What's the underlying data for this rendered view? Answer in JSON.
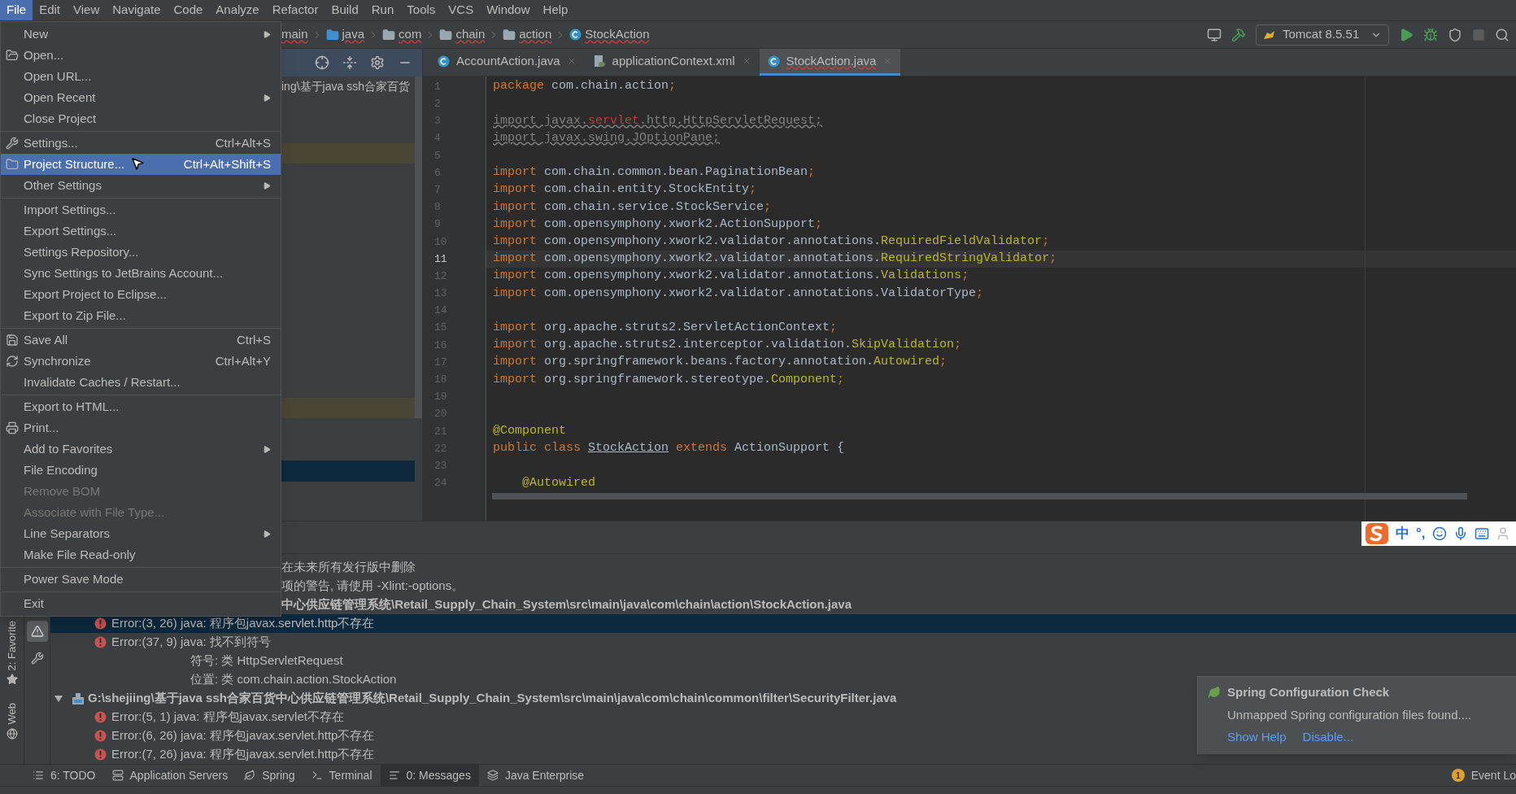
{
  "menubar": [
    {
      "label": "File",
      "selected": true
    },
    {
      "label": "Edit",
      "selected": false
    },
    {
      "label": "View",
      "selected": false
    },
    {
      "label": "Navigate",
      "selected": false
    },
    {
      "label": "Code",
      "selected": false
    },
    {
      "label": "Analyze",
      "selected": false
    },
    {
      "label": "Refactor",
      "selected": false
    },
    {
      "label": "Build",
      "selected": false
    },
    {
      "label": "Run",
      "selected": false
    },
    {
      "label": "Tools",
      "selected": false
    },
    {
      "label": "VCS",
      "selected": false
    },
    {
      "label": "Window",
      "selected": false
    },
    {
      "label": "Help",
      "selected": false
    }
  ],
  "file_menu": [
    [
      {
        "label": "New",
        "submenu": true,
        "disabled": false,
        "selected": false
      },
      {
        "label": "Open...",
        "submenu": false,
        "disabled": false,
        "selected": false
      },
      {
        "label": "Open URL...",
        "submenu": false,
        "disabled": false,
        "selected": false
      },
      {
        "label": "Open Recent",
        "submenu": true,
        "disabled": false,
        "selected": false
      },
      {
        "label": "Close Project",
        "submenu": false,
        "disabled": false,
        "selected": false
      }
    ],
    [
      {
        "label": "Settings...",
        "shortcut": "Ctrl+Alt+S",
        "submenu": false,
        "disabled": false,
        "selected": false
      },
      {
        "label": "Project Structure...",
        "shortcut": "Ctrl+Alt+Shift+S",
        "submenu": false,
        "disabled": false,
        "selected": true
      },
      {
        "label": "Other Settings",
        "submenu": true,
        "disabled": false,
        "selected": false
      }
    ],
    [
      {
        "label": "Import Settings...",
        "submenu": false,
        "disabled": false,
        "selected": false
      },
      {
        "label": "Export Settings...",
        "submenu": false,
        "disabled": false,
        "selected": false
      },
      {
        "label": "Settings Repository...",
        "submenu": false,
        "disabled": false,
        "selected": false
      },
      {
        "label": "Sync Settings to JetBrains Account...",
        "submenu": false,
        "disabled": false,
        "selected": false
      },
      {
        "label": "Export Project to Eclipse...",
        "submenu": false,
        "disabled": false,
        "selected": false
      },
      {
        "label": "Export to Zip File...",
        "submenu": false,
        "disabled": false,
        "selected": false
      }
    ],
    [
      {
        "label": "Save All",
        "shortcut": "Ctrl+S",
        "submenu": false,
        "disabled": false,
        "selected": false
      },
      {
        "label": "Synchronize",
        "shortcut": "Ctrl+Alt+Y",
        "submenu": false,
        "disabled": false,
        "selected": false
      },
      {
        "label": "Invalidate Caches / Restart...",
        "submenu": false,
        "disabled": false,
        "selected": false
      }
    ],
    [
      {
        "label": "Export to HTML...",
        "submenu": false,
        "disabled": false,
        "selected": false
      },
      {
        "label": "Print...",
        "submenu": false,
        "disabled": false,
        "selected": false
      },
      {
        "label": "Add to Favorites",
        "submenu": true,
        "disabled": false,
        "selected": false
      },
      {
        "label": "File Encoding",
        "submenu": false,
        "disabled": false,
        "selected": false
      },
      {
        "label": "Remove BOM",
        "submenu": false,
        "disabled": true,
        "selected": false
      },
      {
        "label": "Associate with File Type...",
        "submenu": false,
        "disabled": true,
        "selected": false
      },
      {
        "label": "Line Separators",
        "submenu": true,
        "disabled": false,
        "selected": false
      },
      {
        "label": "Make File Read-only",
        "submenu": false,
        "disabled": false,
        "selected": false
      }
    ],
    [
      {
        "label": "Power Save Mode",
        "submenu": false,
        "disabled": false,
        "selected": false
      }
    ],
    [
      {
        "label": "Exit",
        "submenu": false,
        "disabled": false,
        "selected": false
      }
    ]
  ],
  "breadcrumbs": [
    "main",
    "java",
    "com",
    "chain",
    "action",
    "StockAction"
  ],
  "run_config": "Tomcat 8.5.51",
  "project_panel": {
    "path": "ing\\基于java ssh合家百货"
  },
  "editor_tabs": [
    {
      "label": "AccountAction.java",
      "selected": false
    },
    {
      "label": "applicationContext.xml",
      "selected": false
    },
    {
      "label": "StockAction.java",
      "selected": true
    }
  ],
  "code_lines": [
    {
      "number": "1",
      "current": false,
      "tokens": [
        {
          "kind": "k",
          "text": "package "
        },
        {
          "kind": "p",
          "text": "com.chain.action"
        },
        {
          "kind": "k",
          "text": ";"
        }
      ]
    },
    {
      "number": "2",
      "current": false
    },
    {
      "number": "3",
      "current": false,
      "tokens": [
        {
          "kind": "u",
          "text": "import javax."
        },
        {
          "kind": "e",
          "text": "servlet"
        },
        {
          "kind": "u",
          "text": ".http.HttpServletRequest;"
        }
      ]
    },
    {
      "number": "4",
      "current": false,
      "tokens": [
        {
          "kind": "u",
          "text": "import javax.swing.JOptionPane;"
        }
      ]
    },
    {
      "number": "5",
      "current": false
    },
    {
      "number": "6",
      "current": false,
      "tokens": [
        {
          "kind": "k",
          "text": "import "
        },
        {
          "kind": "p",
          "text": "com.chain.common.bean.PaginationBean"
        },
        {
          "kind": "k",
          "text": ";"
        }
      ]
    },
    {
      "number": "7",
      "current": false,
      "tokens": [
        {
          "kind": "k",
          "text": "import "
        },
        {
          "kind": "p",
          "text": "com.chain.entity.StockEntity"
        },
        {
          "kind": "k",
          "text": ";"
        }
      ]
    },
    {
      "number": "8",
      "current": false,
      "tokens": [
        {
          "kind": "k",
          "text": "import "
        },
        {
          "kind": "p",
          "text": "com.chain.service.StockService"
        },
        {
          "kind": "k",
          "text": ";"
        }
      ]
    },
    {
      "number": "9",
      "current": false,
      "tokens": [
        {
          "kind": "k",
          "text": "import "
        },
        {
          "kind": "p",
          "text": "com.opensymphony.xwork2.ActionSupport"
        },
        {
          "kind": "k",
          "text": ";"
        }
      ]
    },
    {
      "number": "10",
      "current": false,
      "tokens": [
        {
          "kind": "k",
          "text": "import "
        },
        {
          "kind": "p",
          "text": "com.opensymphony.xwork2.validator.annotations."
        },
        {
          "kind": "a",
          "text": "RequiredFieldValidator"
        },
        {
          "kind": "k",
          "text": ";"
        }
      ]
    },
    {
      "number": "11",
      "current": true,
      "tokens": [
        {
          "kind": "k",
          "text": "import "
        },
        {
          "kind": "p",
          "text": "com.opensymphony.xwork2.validator.annotations."
        },
        {
          "kind": "a",
          "text": "RequiredStringValidator"
        },
        {
          "kind": "k",
          "text": ";"
        }
      ]
    },
    {
      "number": "12",
      "current": false,
      "tokens": [
        {
          "kind": "k",
          "text": "import "
        },
        {
          "kind": "p",
          "text": "com.opensymphony.xwork2.validator.annotations."
        },
        {
          "kind": "a",
          "text": "Validations"
        },
        {
          "kind": "k",
          "text": ";"
        }
      ]
    },
    {
      "number": "13",
      "current": false,
      "tokens": [
        {
          "kind": "k",
          "text": "import "
        },
        {
          "kind": "p",
          "text": "com.opensymphony.xwork2.validator.annotations.ValidatorType"
        },
        {
          "kind": "k",
          "text": ";"
        }
      ]
    },
    {
      "number": "14",
      "current": false
    },
    {
      "number": "15",
      "current": false,
      "tokens": [
        {
          "kind": "k",
          "text": "import "
        },
        {
          "kind": "p",
          "text": "org.apache.struts2.ServletActionContext"
        },
        {
          "kind": "k",
          "text": ";"
        }
      ]
    },
    {
      "number": "16",
      "current": false,
      "tokens": [
        {
          "kind": "k",
          "text": "import "
        },
        {
          "kind": "p",
          "text": "org.apache.struts2.interceptor.validation."
        },
        {
          "kind": "a",
          "text": "SkipValidation"
        },
        {
          "kind": "k",
          "text": ";"
        }
      ]
    },
    {
      "number": "17",
      "current": false,
      "tokens": [
        {
          "kind": "k",
          "text": "import "
        },
        {
          "kind": "p",
          "text": "org.springframework.beans.factory.annotation."
        },
        {
          "kind": "a",
          "text": "Autowired"
        },
        {
          "kind": "k",
          "text": ";"
        }
      ]
    },
    {
      "number": "18",
      "current": false,
      "tokens": [
        {
          "kind": "k",
          "text": "import "
        },
        {
          "kind": "p",
          "text": "org.springframework.stereotype."
        },
        {
          "kind": "a",
          "text": "Component"
        },
        {
          "kind": "k",
          "text": ";"
        }
      ]
    },
    {
      "number": "19",
      "current": false
    },
    {
      "number": "20",
      "current": false
    },
    {
      "number": "21",
      "current": false,
      "tokens": [
        {
          "kind": "a",
          "text": "@Component"
        }
      ]
    },
    {
      "number": "22",
      "current": false,
      "tokens": [
        {
          "kind": "k",
          "text": "public class "
        },
        {
          "kind": "c",
          "text": "StockAction"
        },
        {
          "kind": "k",
          "text": " extends "
        },
        {
          "kind": "p",
          "text": "ActionSupport {"
        }
      ]
    },
    {
      "number": "23",
      "current": false
    },
    {
      "number": "24",
      "current": false,
      "tokens": [
        {
          "kind": "a",
          "text": "    @Autowired"
        }
      ]
    }
  ],
  "ime_bar": [
    "中",
    "°,"
  ],
  "messages": [
    {
      "kind": "clipped_text",
      "text": "在未来所有发行版中删除",
      "selected": false
    },
    {
      "kind": "clipped_text",
      "text": "项的警告, 请使用 -Xlint:-options。",
      "selected": false
    },
    {
      "kind": "clipped_file",
      "text": "中心供应链管理系统\\Retail_Supply_Chain_System\\src\\main\\java\\com\\chain\\action\\StockAction.java",
      "selected": false
    },
    {
      "kind": "error",
      "text": "Error:(3, 26)  java: 程序包javax.servlet.http不存在",
      "selected": true
    },
    {
      "kind": "error",
      "text": "Error:(37, 9)  java: 找不到符号",
      "selected": false
    },
    {
      "kind": "detail",
      "text": "符号:   类 HttpServletRequest",
      "selected": false
    },
    {
      "kind": "detail",
      "text": "位置: 类 com.chain.action.StockAction",
      "selected": false
    },
    {
      "kind": "file",
      "text": "G:\\shejiing\\基于java ssh合家百货中心供应链管理系统\\Retail_Supply_Chain_System\\src\\main\\java\\com\\chain\\common\\filter\\SecurityFilter.java",
      "selected": false,
      "expanded": true
    },
    {
      "kind": "error",
      "text": "Error:(5, 1)  java: 程序包javax.servlet不存在",
      "selected": false
    },
    {
      "kind": "error",
      "text": "Error:(6, 26)  java: 程序包javax.servlet.http不存在",
      "selected": false
    },
    {
      "kind": "error",
      "text": "Error:(7, 26)  java: 程序包javax.servlet.http不存在",
      "selected": false
    }
  ],
  "side_tools": [
    "2: Favorite",
    "Web"
  ],
  "notification": {
    "title": "Spring Configuration Check",
    "body": "Unmapped Spring configuration files found....",
    "links": [
      "Show Help",
      "Disable..."
    ]
  },
  "tool_tabs": [
    {
      "label": "6: TODO",
      "selected": false
    },
    {
      "label": "Application Servers",
      "selected": false
    },
    {
      "label": "Spring",
      "selected": false
    },
    {
      "label": "Terminal",
      "selected": false
    },
    {
      "label": "0: Messages",
      "selected": true
    },
    {
      "label": "Java Enterprise",
      "selected": false
    }
  ],
  "event_log": {
    "badge": "1",
    "label": "Event Lo"
  }
}
